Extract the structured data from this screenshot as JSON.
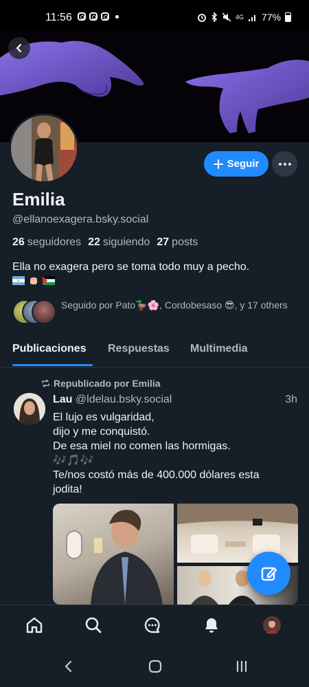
{
  "status_bar": {
    "time": "11:56",
    "network": "4G",
    "battery": "77%",
    "notification_icons": [
      "instagram-icon",
      "instagram-icon",
      "instagram-icon",
      "dot-icon"
    ]
  },
  "profile": {
    "display_name": "Emilia",
    "handle": "@ellanoexagera.bsky.social",
    "follow_label": "Seguir",
    "stats": {
      "followers_count": "26",
      "followers_label": "seguidores",
      "following_count": "22",
      "following_label": "siguiendo",
      "posts_count": "27",
      "posts_label": "posts"
    },
    "bio": "Ella no exagera pero se toma todo muy a pecho.",
    "followed_by": "Seguido por Pato🦆🌸, Cordobesaso 😎, y 17 others"
  },
  "tabs": [
    "Publicaciones",
    "Respuestas",
    "Multimedia"
  ],
  "post": {
    "repost_label": "Republicado por Emilia",
    "author": "Lau",
    "author_handle": "@ldelau.bsky.social",
    "time": "3h",
    "lines": [
      "El lujo es vulgaridad,",
      "dijo y me conquistó.",
      "De esa miel no comen las hormigas.",
      "🎶🎵🎶",
      "Te/nos costó más de 400.000 dólares esta",
      "jodita!"
    ]
  },
  "colors": {
    "accent": "#208bfe",
    "background": "#161e27",
    "muted_text": "#aeb9c4"
  },
  "bottom_nav": [
    "home-icon",
    "search-icon",
    "chat-icon",
    "bell-icon",
    "profile-avatar"
  ]
}
